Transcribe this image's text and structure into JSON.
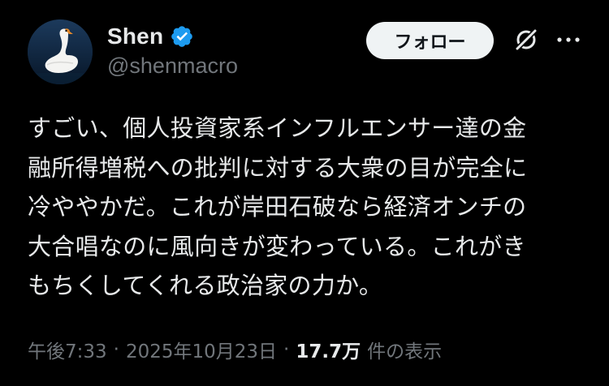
{
  "author": {
    "display_name": "Shen",
    "handle": "@shenmacro",
    "verified": true,
    "avatar_icon": "swan-avatar"
  },
  "actions": {
    "follow_label": "フォロー",
    "grok_icon": "grok-icon",
    "more_icon": "more-horizontal-icon"
  },
  "tweet": {
    "lines": [
      "すごい、個人投資家系インフルエンサー達の金",
      "融所得増税への批判に対する大衆の目が完全に",
      "冷ややかだ。これが岸田石破なら経済オンチの",
      "大合唱なのに風向きが変わっている。これがき",
      "もちくしてくれる政治家の力か。"
    ]
  },
  "meta": {
    "time": "午後7:33",
    "separator": "·",
    "date": "2025年10月23日",
    "views_count": "17.7万",
    "views_label": "件の表示"
  },
  "colors": {
    "background": "#000000",
    "text_primary": "#e7e9ea",
    "text_secondary": "#71767b",
    "verified_blue": "#1d9bf0",
    "button_bg": "#eff3f4"
  }
}
